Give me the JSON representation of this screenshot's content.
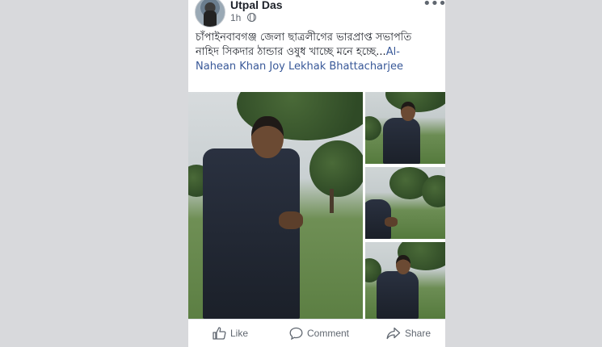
{
  "post": {
    "author": "Utpal Das",
    "time": "1h",
    "more_icon": "more-options-icon",
    "privacy_icon": "globe-icon",
    "text": "চাঁপাইনবাবগঞ্জ জেলা ছাত্রলীগের ভারপ্রাপ্ত সভাপতি নাহিদ সিকদার ঠান্ডার ওষুধ খাচ্ছে মনে হচ্ছে...",
    "mention": "Al-Nahean Khan Joy Lekhak Bhattacharjee",
    "photo_count": 4
  },
  "actions": {
    "like": "Like",
    "comment": "Comment",
    "share": "Share"
  },
  "colors": {
    "link": "#385898",
    "text": "#1d2129",
    "secondary": "#606770",
    "background": "#d8d9dc"
  }
}
